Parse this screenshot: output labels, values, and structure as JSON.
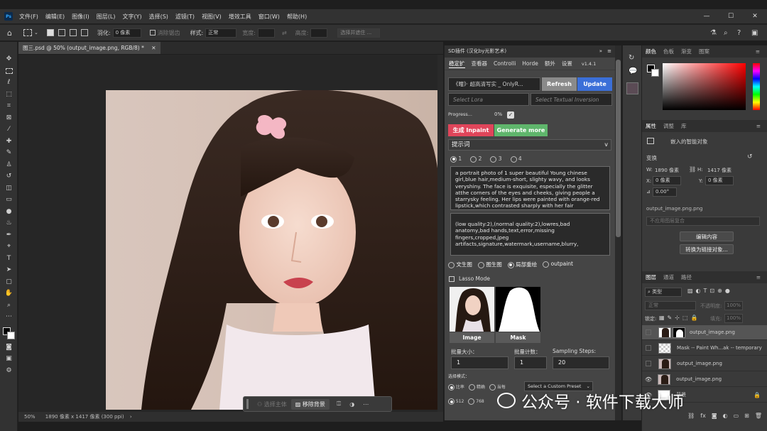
{
  "menubar": {
    "logo": "Ps",
    "items": [
      "文件(F)",
      "编辑(E)",
      "图像(I)",
      "图层(L)",
      "文字(Y)",
      "选择(S)",
      "滤镜(T)",
      "视图(V)",
      "增效工具",
      "窗口(W)",
      "帮助(H)"
    ]
  },
  "options_bar": {
    "feather_label": "羽化:",
    "feather_value": "0 像素",
    "antialias_label": "消除锯齿",
    "style_label": "样式:",
    "style_value": "正常",
    "width_label": "宽度:",
    "height_label": "高度:",
    "select_subject": "选择并遮住 ..."
  },
  "document": {
    "tab_title": "图三.psd @ 50% (output_image.png, RGB/8) *",
    "zoom": "50%",
    "info": "1890 像素 x 1417 像素 (300 ppi)"
  },
  "context_bar": {
    "select_subject": "选择主体",
    "remove_bg": "移除背景"
  },
  "sd_panel": {
    "title": "SD插件 (汉化by光影艺术)",
    "tabs": [
      "稳定扩",
      "查看器",
      "Controlli",
      "Horde",
      "额外",
      "设置"
    ],
    "version": "v1.4.1",
    "model_value": "《疃》· 超高清写实 _ OnlyR...",
    "refresh": "Refresh",
    "update": "Update",
    "select_lora": "Select Lora",
    "select_ti": "Select Textual Inversion",
    "progress_label": "Progress...",
    "progress_value": "0%",
    "generate": "生成 Inpaint",
    "generate_more": "Generate more",
    "prompt_header": "提示词",
    "prompt_tabs": [
      "1",
      "2",
      "3",
      "4"
    ],
    "positive_prompt": "a portrait photo of 1 super beautiful Young chinese girl,blue hair,medium-short, slighty wavy, and looks veryshiny. The face is exquisite, especially the glitter atthe corners of the eyes and cheeks, giving people a starrysky feeling. Her lips were painted with orange-red lipstick,which contrasted sharply with her fair complexion.",
    "negative_prompt": "(low quality:2),(normal quality:2),lowres,bad anatomy,bad hands,text,error,missing fingers,cropped,jpeg artifacts,signature,watermark,username,blurry,",
    "modes": [
      "文生图",
      "图生图",
      "局部重绘",
      "outpaint"
    ],
    "lasso_label": "Lasso Mode",
    "image_label": "Image",
    "mask_label": "Mask",
    "batch_size_label": "批量大小：",
    "batch_size": "1",
    "batch_count_label": "批量计数：",
    "batch_count": "1",
    "steps_label": "Sampling Steps:",
    "steps": "20",
    "size_mode_label": "选择模式：",
    "size_opts": [
      "比率",
      "精确",
      "当每"
    ],
    "preset_placeholder": "Select a Custom Preset",
    "size_row2": [
      "512",
      "768"
    ]
  },
  "color_panel": {
    "tabs": [
      "颜色",
      "色板",
      "渐变",
      "图案"
    ]
  },
  "properties_panel": {
    "tabs": [
      "属性",
      "调整",
      "库"
    ],
    "object_type": "嵌入的智能对象",
    "transform_label": "变换",
    "w_label": "W:",
    "w_value": "1890 像素",
    "h_label": "H:",
    "h_value": "1417 像素",
    "x_label": "X:",
    "x_value": "0 像素",
    "y_label": "Y:",
    "y_value": "0 像素",
    "angle_value": "0.00°",
    "filename": "output_image.png.png",
    "layer_comp": "不应用图层复合",
    "edit_contents": "编辑内容",
    "convert_linked": "转换为链接对象..."
  },
  "layers_panel": {
    "tabs": [
      "图层",
      "通道",
      "路径"
    ],
    "filter_kind": "类型",
    "blend_mode": "正常",
    "opacity_label": "不透明度:",
    "opacity_value": "100%",
    "lock_label": "锁定:",
    "fill_label": "填充:",
    "fill_value": "100%",
    "layers": [
      {
        "name": "output_image.png",
        "visible": false,
        "selected": true
      },
      {
        "name": "Mask -- Paint Wh...ak -- temporary",
        "visible": false,
        "selected": false
      },
      {
        "name": "output_image.png",
        "visible": false,
        "selected": false
      },
      {
        "name": "output_image.png",
        "visible": true,
        "selected": false
      },
      {
        "name": "背景",
        "visible": true,
        "selected": false
      }
    ]
  },
  "watermark": {
    "text": "公众号 · 软件下载大师"
  }
}
